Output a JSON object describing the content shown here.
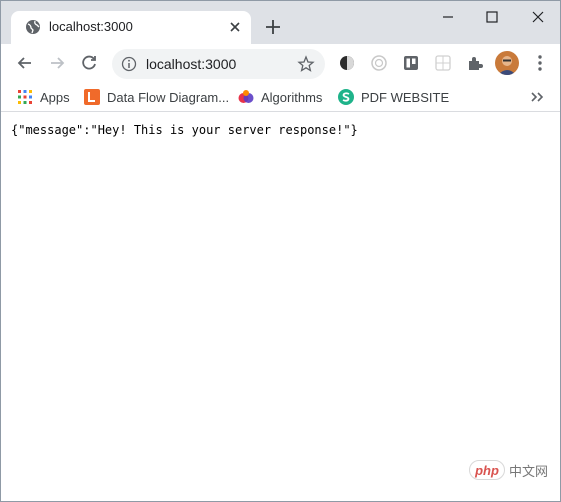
{
  "browser": {
    "tab": {
      "title": "localhost:3000",
      "favicon": "globe-icon"
    },
    "omnibox": {
      "url": "localhost:3000"
    },
    "bookmarks": [
      {
        "label": "Apps",
        "icon": "apps-grid-icon"
      },
      {
        "label": "Data Flow Diagram...",
        "icon": "dfd-icon"
      },
      {
        "label": "Algorithms",
        "icon": "algorithms-icon"
      },
      {
        "label": "PDF WEBSITE",
        "icon": "pdf-website-icon"
      }
    ],
    "extensions": [
      "dark-reader-icon",
      "extension-circle-icon",
      "trello-icon",
      "grid-extension-icon",
      "puzzle-icon"
    ]
  },
  "page": {
    "response_text": "{\"message\":\"Hey! This is your server response!\"}"
  },
  "watermark": {
    "logo_text": "php",
    "site_text": "中文网"
  },
  "colors": {
    "tabstrip": "#dee1e6",
    "omnibox": "#f1f3f4",
    "dfd_orange": "#f06a2a",
    "pdf_green": "#1fb38a"
  }
}
